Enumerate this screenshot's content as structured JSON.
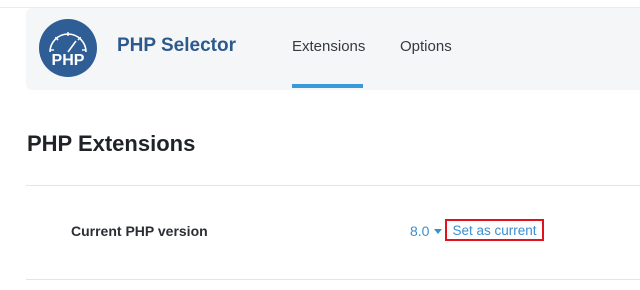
{
  "header": {
    "logo_text": "PHP",
    "app_title": "PHP Selector",
    "tabs": [
      {
        "label": "Extensions",
        "active": true
      },
      {
        "label": "Options",
        "active": false
      }
    ]
  },
  "main": {
    "page_title": "PHP Extensions",
    "row": {
      "label": "Current PHP version",
      "selected_version": "8.0",
      "action_label": "Set as current"
    }
  },
  "colors": {
    "brand_blue": "#2c5a8c",
    "link_blue": "#3a8fd0",
    "active_tab_underline": "#3a9ad9",
    "highlight_red": "#e0121b",
    "header_bg": "#f5f6f7"
  },
  "icons": {
    "logo": "php-speedometer-logo",
    "dropdown": "caret-down-icon"
  }
}
